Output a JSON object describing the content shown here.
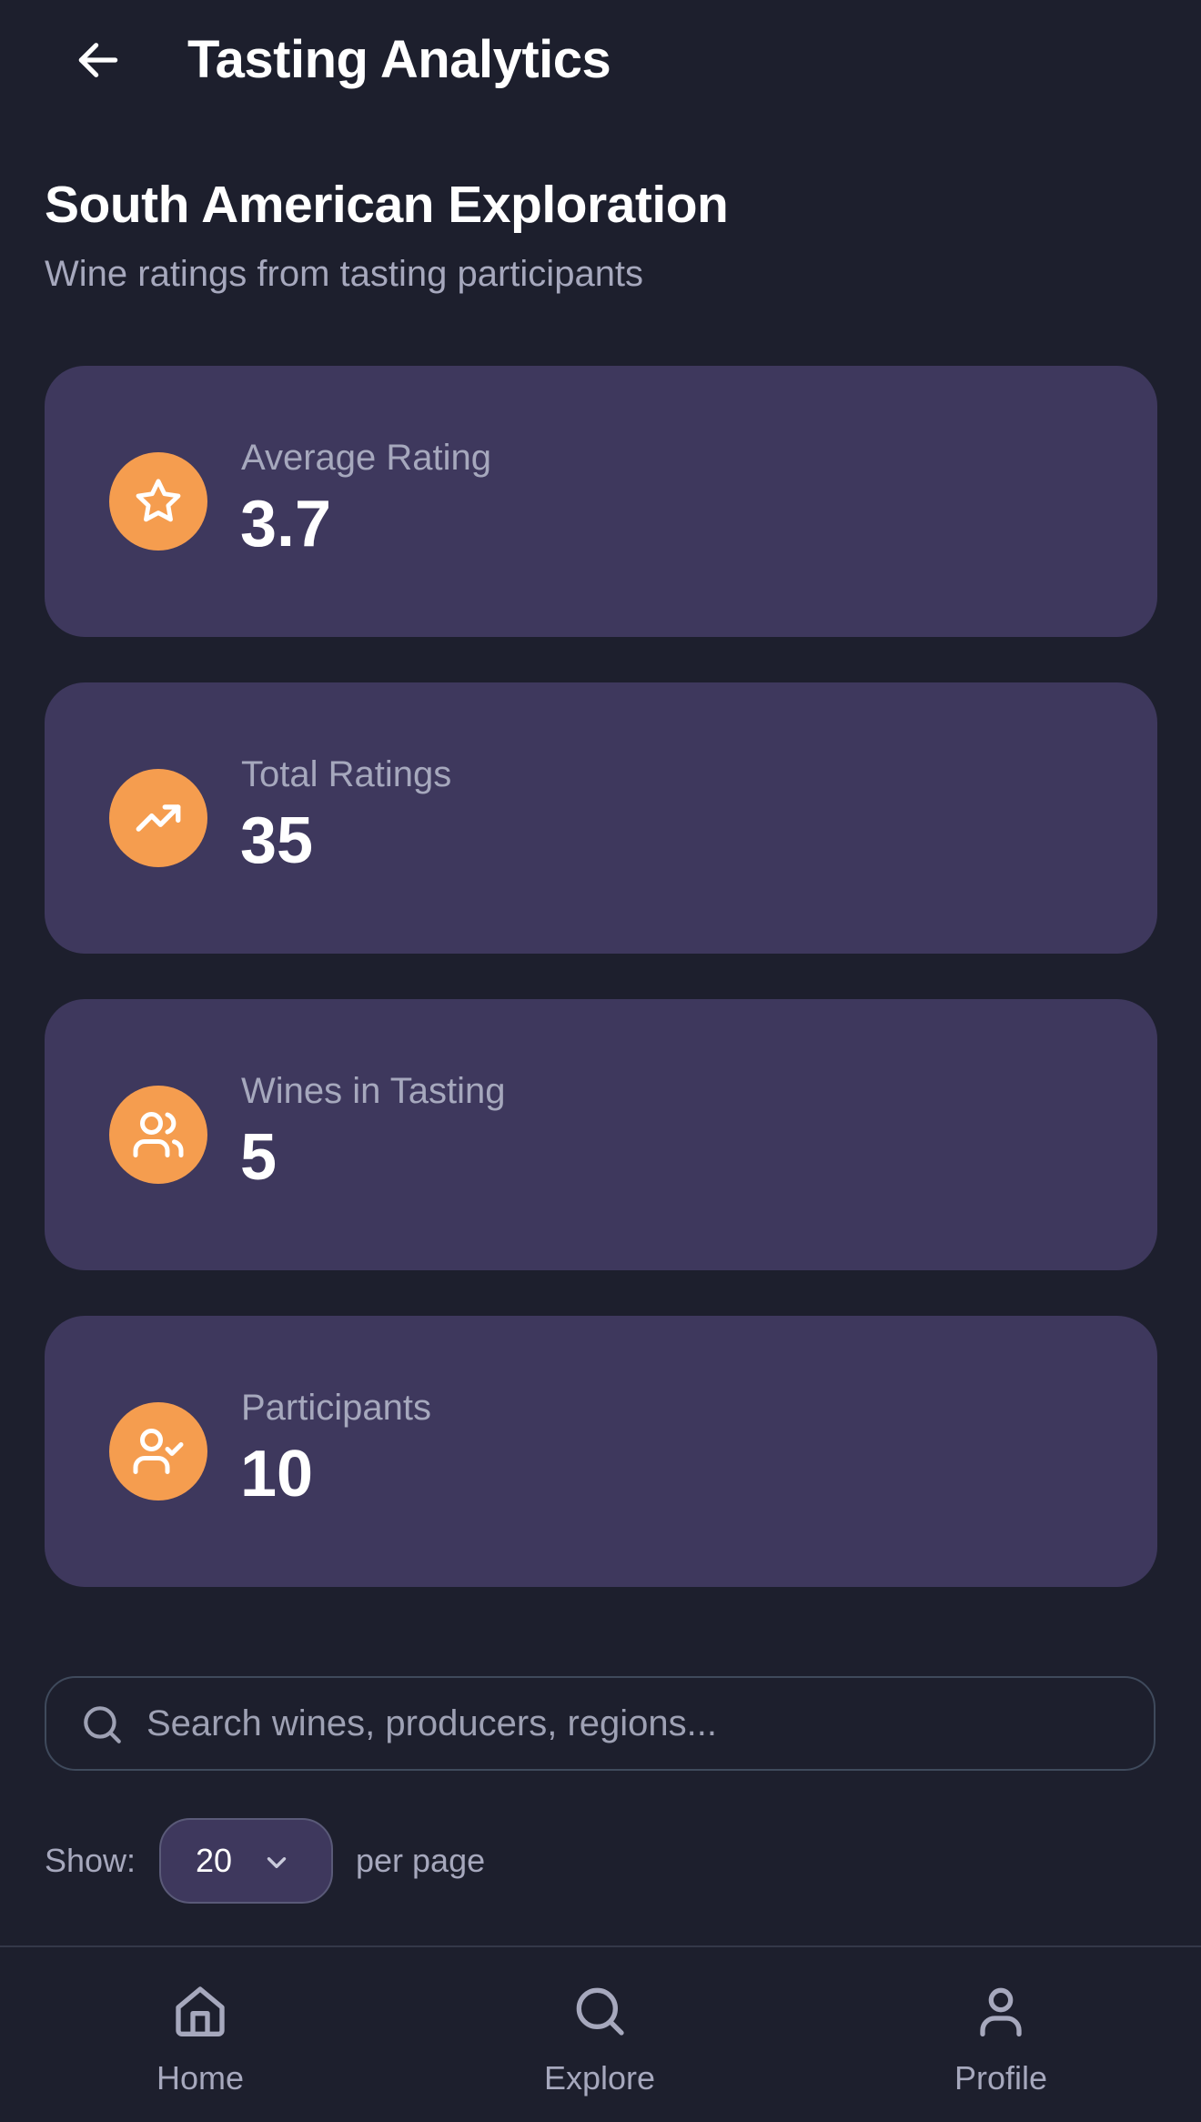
{
  "header": {
    "title": "Tasting Analytics",
    "back_icon": "arrow-left-icon"
  },
  "page": {
    "title": "South American Exploration",
    "subtitle": "Wine ratings from tasting participants"
  },
  "stats": [
    {
      "label": "Average Rating",
      "value": "3.7",
      "icon": "star-icon"
    },
    {
      "label": "Total Ratings",
      "value": "35",
      "icon": "trending-up-icon"
    },
    {
      "label": "Wines in Tasting",
      "value": "5",
      "icon": "users-icon"
    },
    {
      "label": "Participants",
      "value": "10",
      "icon": "user-check-icon"
    }
  ],
  "search": {
    "placeholder": "Search wines, producers, regions...",
    "value": ""
  },
  "pagination": {
    "show_label": "Show:",
    "per_page_value": "20",
    "per_page_suffix": "per page"
  },
  "nav": {
    "items": [
      {
        "label": "Home",
        "icon": "home-icon"
      },
      {
        "label": "Explore",
        "icon": "search-icon"
      },
      {
        "label": "Profile",
        "icon": "user-icon"
      }
    ]
  },
  "colors": {
    "background": "#1d1f2d",
    "card": "#3e385d",
    "accent": "#f59d4f",
    "muted_text": "#a6a8bd"
  }
}
